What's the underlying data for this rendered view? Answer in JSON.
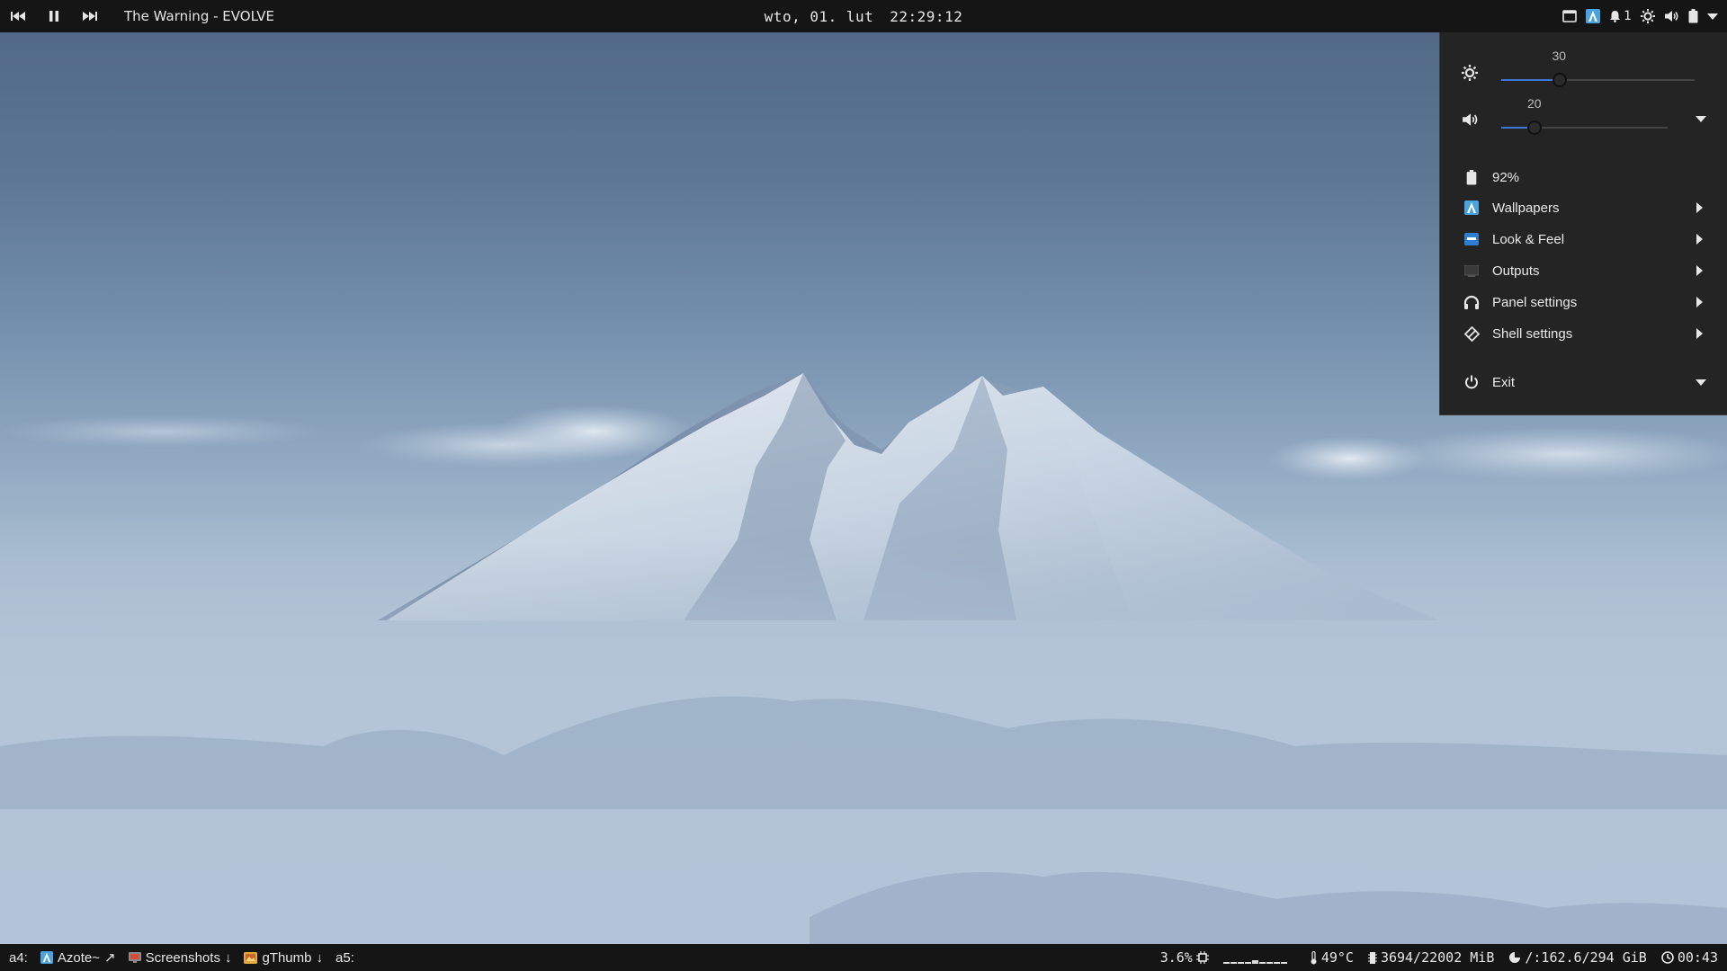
{
  "topbar": {
    "media": {
      "prev_icon": "previous-track-icon",
      "pause_icon": "pause-icon",
      "next_icon": "next-track-icon",
      "now_playing": "The Warning - EVOLVE"
    },
    "clock": {
      "date": "wto, 01. lut",
      "time": "22:29:12"
    },
    "tray": {
      "icons": [
        "window-icon",
        "azote-icon",
        "bell-icon",
        "brightness-icon",
        "volume-icon",
        "battery-icon",
        "chevron-down-icon"
      ],
      "notification_count": "1"
    }
  },
  "popup": {
    "brightness": {
      "icon": "brightness-icon",
      "value": "30",
      "level": 0.3
    },
    "volume": {
      "icon": "volume-icon",
      "value": "20",
      "level": 0.2
    },
    "battery": {
      "icon": "battery-icon",
      "label": "92%"
    },
    "items": [
      {
        "label": "Wallpapers",
        "icon": "azote-icon"
      },
      {
        "label": "Look & Feel",
        "icon": "window-settings-icon"
      },
      {
        "label": "Outputs",
        "icon": "display-icon"
      },
      {
        "label": "Panel settings",
        "icon": "headphones-icon"
      },
      {
        "label": "Shell settings",
        "icon": "shell-icon"
      }
    ],
    "exit": {
      "label": "Exit",
      "icon": "power-icon"
    }
  },
  "bottombar": {
    "workspace_a4": "a4:",
    "tasks": [
      {
        "label": "Azote~",
        "icon": "azote-icon",
        "marker": "↗"
      },
      {
        "label": "Screenshots",
        "icon": "screenshot-icon",
        "marker": "↓"
      },
      {
        "label": "gThumb",
        "icon": "gthumb-icon",
        "marker": "↓"
      }
    ],
    "workspace_a5": "a5:",
    "status": {
      "cpu": "3.6%",
      "temperature": "49°C",
      "memory": "3694/22002 MiB",
      "disk": "/:162.6/294 GiB",
      "uptime": "00:43"
    }
  },
  "colors": {
    "bar_bg": "#151515",
    "popup_bg": "#242424",
    "accent": "#3d77d6"
  }
}
